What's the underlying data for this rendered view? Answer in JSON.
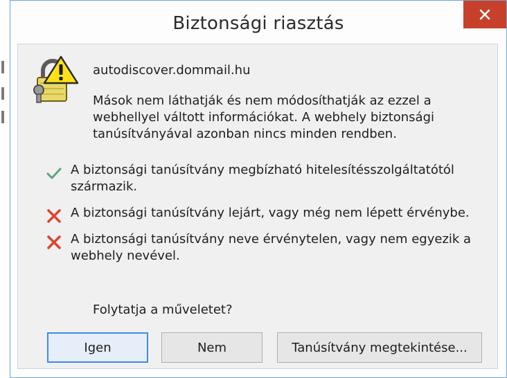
{
  "dialog": {
    "title": "Biztonsági riasztás",
    "hostname": "autodiscover.dommail.hu",
    "description": "Mások nem láthatják és nem módosíthatják az ezzel a webhellyel váltott információkat. A webhely biztonsági tanúsítványával azonban nincs minden rendben.",
    "checks": [
      {
        "status": "ok",
        "icon": "check-icon",
        "text": "A biztonsági tanúsítvány megbízható hitelesítésszolgáltatótól származik."
      },
      {
        "status": "error",
        "icon": "x-icon",
        "text": "A biztonsági tanúsítvány lejárt, vagy még nem lépett érvénybe."
      },
      {
        "status": "error",
        "icon": "x-icon",
        "text": "A biztonsági tanúsítvány neve érvénytelen, vagy nem egyezik a webhely nevével."
      }
    ],
    "question": "Folytatja a műveletet?",
    "buttons": {
      "yes": "Igen",
      "no": "Nem",
      "view_certificate": "Tanúsítvány megtekintése..."
    }
  },
  "colors": {
    "close_button": "#c7402c",
    "ok_mark": "#5aa87a",
    "error_mark": "#d9462e",
    "default_button_border": "#3c8ce0"
  }
}
